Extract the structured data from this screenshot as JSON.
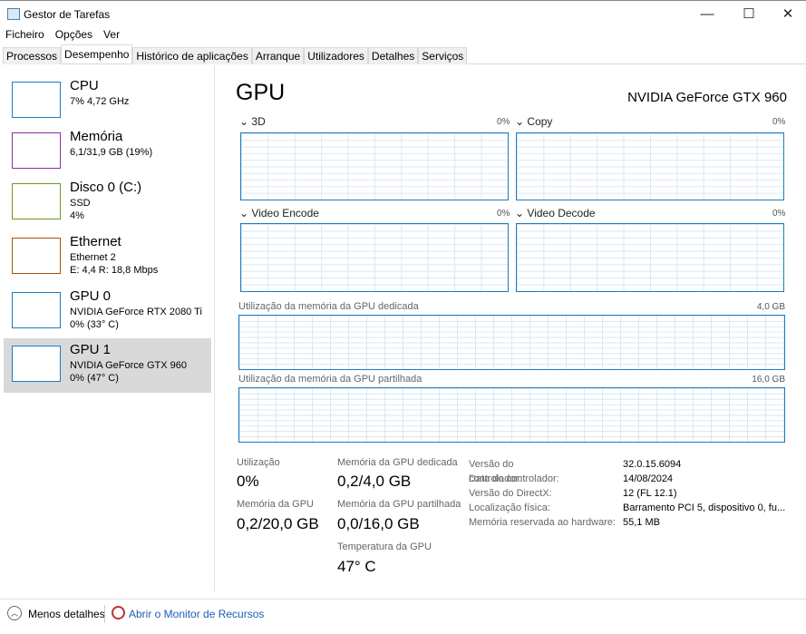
{
  "window": {
    "title": "Gestor de Tarefas",
    "minimize": "—",
    "maximize": "☐",
    "close": "✕"
  },
  "menu": [
    "Ficheiro",
    "Opções",
    "Ver"
  ],
  "tabs": [
    "Processos",
    "Desempenho",
    "Histórico de aplicações",
    "Arranque",
    "Utilizadores",
    "Detalhes",
    "Serviços"
  ],
  "sidebar": [
    {
      "name": "CPU",
      "line1": "7% 4,72 GHz",
      "line2": "",
      "color": "#1c7cc0"
    },
    {
      "name": "Memória",
      "line1": "6,1/31,9 GB (19%)",
      "line2": "",
      "color": "#8b2ea8"
    },
    {
      "name": "Disco 0 (C:)",
      "line1": "SSD",
      "line2": "4%",
      "color": "#6a9a1f"
    },
    {
      "name": "Ethernet",
      "line1": "Ethernet 2",
      "line2": "E: 4,4 R: 18,8 Mbps",
      "color": "#a7530b"
    },
    {
      "name": "GPU 0",
      "line1": "NVIDIA GeForce RTX 2080 Ti",
      "line2": "0% (33° C)",
      "color": "#1c7cc0"
    },
    {
      "name": "GPU 1",
      "line1": "NVIDIA GeForce GTX 960",
      "line2": "0% (47° C)",
      "color": "#1c7cc0"
    }
  ],
  "main": {
    "title": "GPU",
    "device": "NVIDIA GeForce GTX 960",
    "engines": [
      {
        "label": "3D",
        "pct": "0%"
      },
      {
        "label": "Copy",
        "pct": "0%"
      },
      {
        "label": "Video Encode",
        "pct": "0%"
      },
      {
        "label": "Video Decode",
        "pct": "0%"
      }
    ],
    "dedicated": {
      "label": "Utilização da memória da GPU dedicada",
      "max": "4,0 GB"
    },
    "shared": {
      "label": "Utilização da memória da GPU partilhada",
      "max": "16,0 GB"
    },
    "stats": {
      "util_label": "Utilização",
      "util": "0%",
      "gpumem_label": "Memória da GPU",
      "gpumem": "0,2/20,0 GB",
      "ded_label": "Memória da GPU dedicada",
      "ded": "0,2/4,0 GB",
      "sh_label": "Memória da GPU partilhada",
      "sh": "0,0/16,0 GB",
      "temp_label": "Temperatura da GPU",
      "temp": "47° C"
    },
    "details": [
      {
        "k": "Versão do controlador:",
        "v": "32.0.15.6094"
      },
      {
        "k": "Data do controlador:",
        "v": "14/08/2024"
      },
      {
        "k": "Versão do DirectX:",
        "v": "12 (FL 12.1)"
      },
      {
        "k": "Localização física:",
        "v": "Barramento PCI 5, dispositivo 0, fu..."
      },
      {
        "k": "Memória reservada ao hardware:",
        "v": "55,1 MB"
      }
    ]
  },
  "footer": {
    "less": "Menos detalhes",
    "monitor": "Abrir o Monitor de Recursos"
  }
}
